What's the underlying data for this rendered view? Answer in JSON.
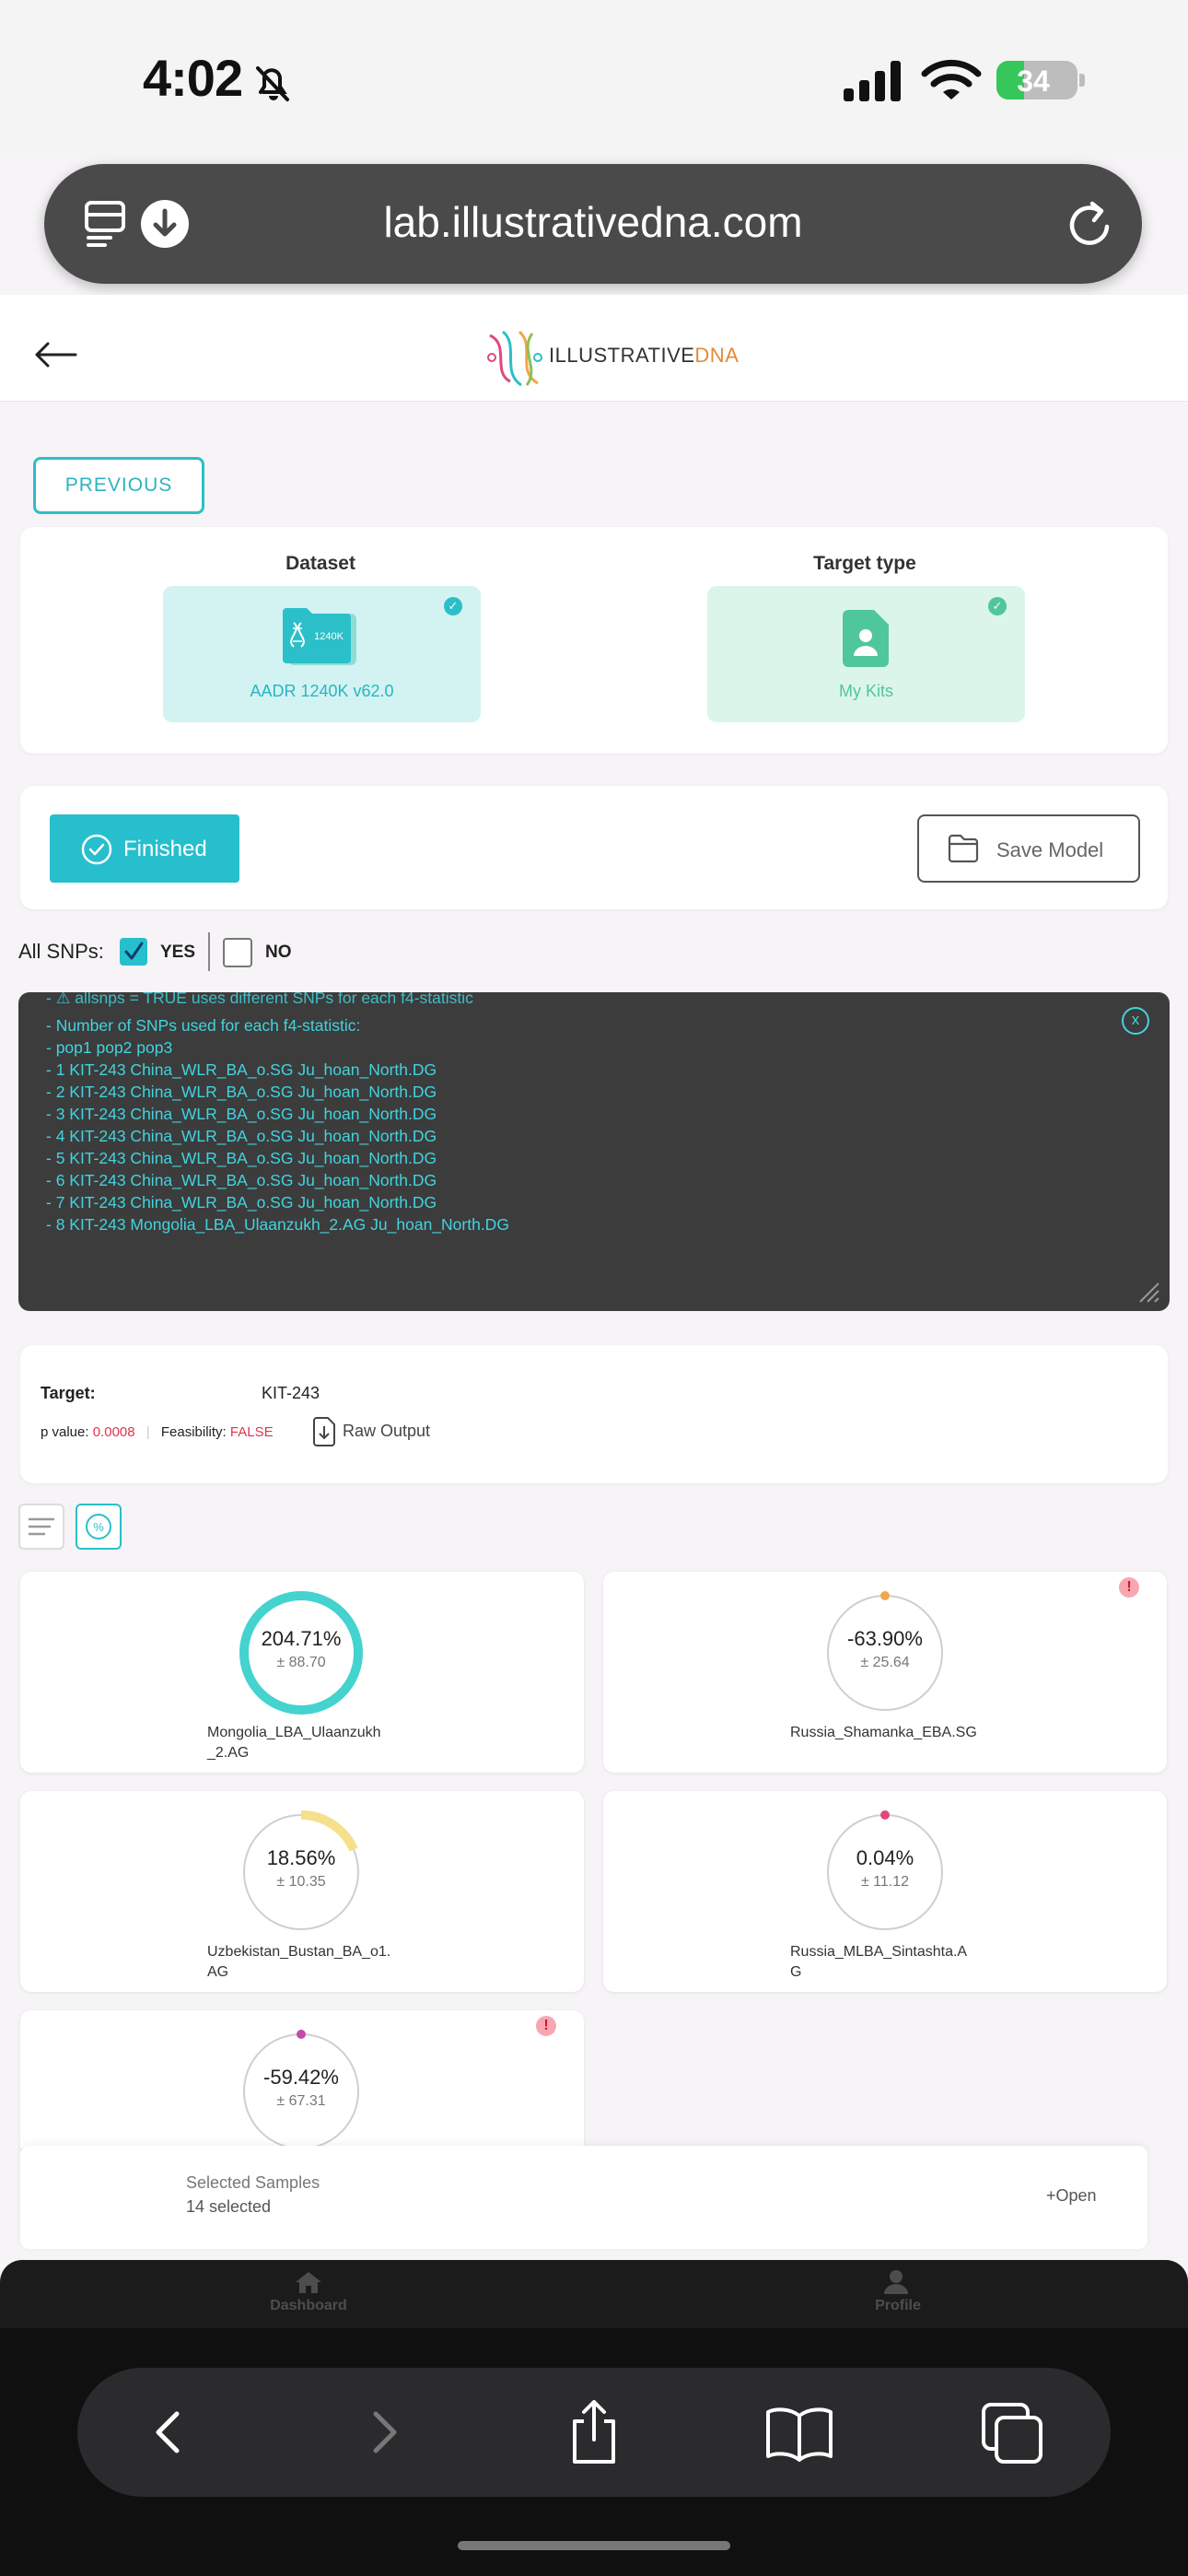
{
  "status": {
    "time": "4:02",
    "battery": "34"
  },
  "browser": {
    "url": "lab.illustrativedna.com"
  },
  "header": {
    "logo_main": "ILLUSTRATIVE",
    "logo_accent": "DNA"
  },
  "actions": {
    "previous": "PREVIOUS",
    "finished": "Finished",
    "save_model": "Save Model"
  },
  "selection": {
    "dataset_title": "Dataset",
    "dataset_value": "AADR 1240K v62.0",
    "dataset_icon_text": "1240K",
    "target_type_title": "Target type",
    "target_type_value": "My Kits"
  },
  "snps": {
    "label": "All SNPs:",
    "yes": "YES",
    "no": "NO"
  },
  "console": {
    "close": "x",
    "lines": [
      "- ⚠ allsnps = TRUE  uses different SNPs for each f4-statistic",
      "- Number of SNPs used for each f4-statistic:",
      "- pop1 pop2 pop3",
      "- 1 KIT-243 China_WLR_BA_o.SG Ju_hoan_North.DG",
      "- 2 KIT-243 China_WLR_BA_o.SG Ju_hoan_North.DG",
      "- 3 KIT-243 China_WLR_BA_o.SG Ju_hoan_North.DG",
      "- 4 KIT-243 China_WLR_BA_o.SG Ju_hoan_North.DG",
      "- 5 KIT-243 China_WLR_BA_o.SG Ju_hoan_North.DG",
      "- 6 KIT-243 China_WLR_BA_o.SG Ju_hoan_North.DG",
      "- 7 KIT-243 China_WLR_BA_o.SG Ju_hoan_North.DG",
      "- 8 KIT-243 Mongolia_LBA_Ulaanzukh_2.AG Ju_hoan_North.DG"
    ]
  },
  "result": {
    "target_label": "Target:",
    "target_value": "KIT-243",
    "p_label": "p value:",
    "p_value": "0.0008",
    "feasibility_label": "Feasibility:",
    "feasibility_value": "FALSE",
    "raw_output": "Raw Output",
    "percent_icon": "%"
  },
  "populations": [
    {
      "value": "204.71%",
      "error": "± 88.70",
      "name1": "Mongolia_LBA_Ulaanzukh",
      "name2": "_2.AG",
      "fraction": 1.0,
      "color": "#44d3cf",
      "warn": false
    },
    {
      "value": "-63.90%",
      "error": "± 25.64",
      "name1": "Russia_Shamanka_EBA.SG",
      "name2": "",
      "fraction": 0,
      "color": "#f2a54a",
      "warn": true
    },
    {
      "value": "18.56%",
      "error": "± 10.35",
      "name1": "Uzbekistan_Bustan_BA_o1.",
      "name2": "AG",
      "fraction": 0.1856,
      "color": "#f7e08b",
      "warn": false
    },
    {
      "value": "0.04%",
      "error": "± 11.12",
      "name1": "Russia_MLBA_Sintashta.A",
      "name2": "G",
      "fraction": 0.0004,
      "color": "#e0487c",
      "warn": false
    },
    {
      "value": "-59.42%",
      "error": "± 67.31",
      "name1": "",
      "name2": "",
      "fraction": 0,
      "color": "#c44aa8",
      "warn": true
    }
  ],
  "selected": {
    "title": "Selected Samples",
    "count": "14 selected",
    "open": "+Open"
  },
  "nav": {
    "dashboard": "Dashboard",
    "profile": "Profile"
  },
  "colors": {
    "accent": "#27bfcd",
    "danger": "#e0334f"
  }
}
